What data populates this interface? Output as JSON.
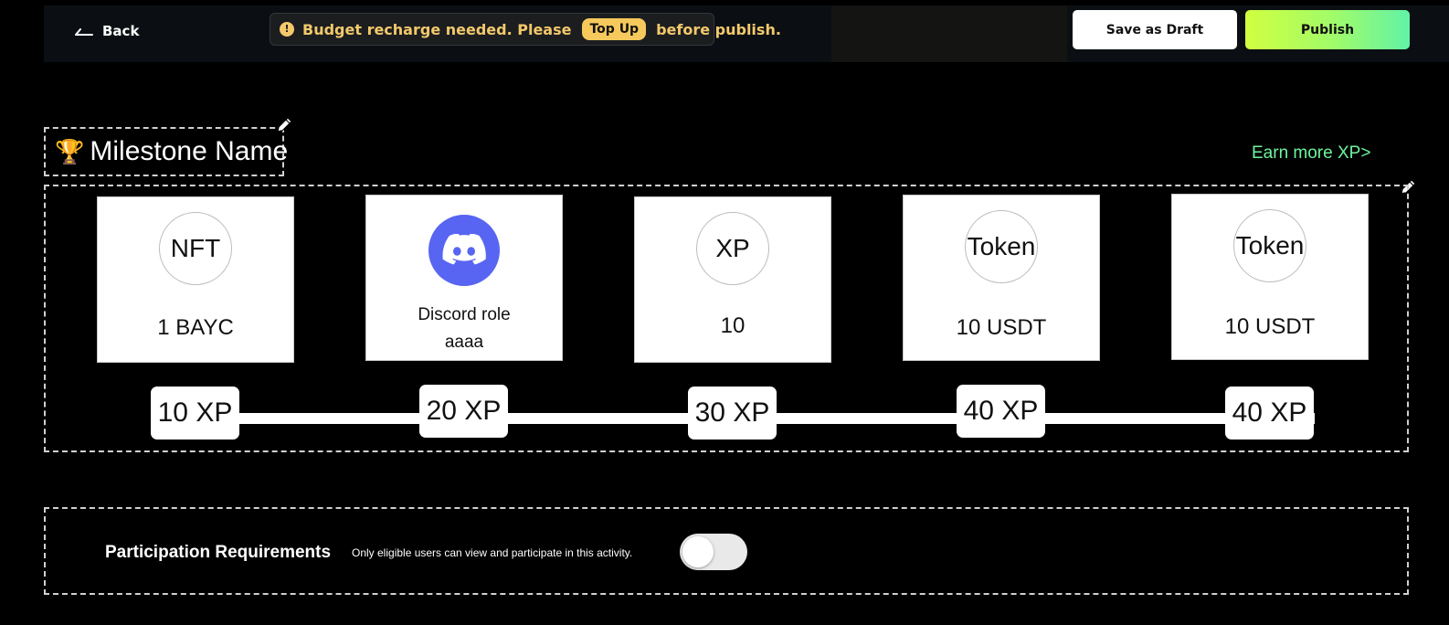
{
  "header": {
    "back_label": "Back",
    "notice": {
      "text_before": "Budget recharge needed. Please",
      "topup_label": "Top Up",
      "text_after": "before publish."
    },
    "save_draft_label": "Save as Draft",
    "publish_label": "Publish"
  },
  "milestone": {
    "title_icon": "trophy-icon",
    "title": "Milestone Name",
    "earn_more_label": "Earn more XP>",
    "rewards": [
      {
        "icon_text": "NFT",
        "label": "1 BAYC",
        "xp": "10 XP"
      },
      {
        "icon": "discord-icon",
        "label_line1": "Discord role",
        "label_line2": "aaaa",
        "xp": "20 XP"
      },
      {
        "icon_text": "XP",
        "label": "10",
        "xp": "30 XP"
      },
      {
        "icon_text": "Token",
        "label": "10 USDT",
        "xp": "40 XP"
      },
      {
        "icon_text": "Token",
        "label": "10 USDT",
        "xp": "40 XP"
      }
    ]
  },
  "participation": {
    "title": "Participation Requirements",
    "description": "Only eligible users can view and participate in this activity.",
    "toggle_on": false
  },
  "colors": {
    "publish_gradient_start": "#d1ff3f",
    "publish_gradient_end": "#62f2a6",
    "earn_more": "#6ef59d",
    "notice_text": "#f3c96b",
    "discord": "#5865f2"
  }
}
